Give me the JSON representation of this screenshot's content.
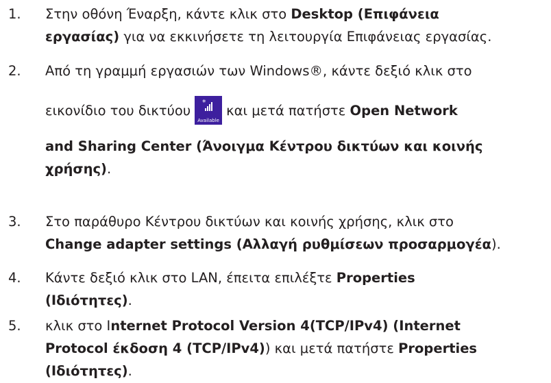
{
  "steps": [
    {
      "number": "1.",
      "line1_pre": "Στην οθόνη Έναρξη, κάντε κλικ στο ",
      "line1_bold": "Desktop (Επιφάνεια",
      "line2_bold": "εργασίας)",
      "line2_post": " για να εκκινήσετε τη λειτουργία Επιφάνειας εργασίας."
    },
    {
      "number": "2.",
      "line1": "Από τη γραμμή εργασιών των Windows®, κάντε δεξιό κλικ στο",
      "line2_pre": "εικονίδιο του δικτύου",
      "icon": {
        "name": "network-icon",
        "label": "Available",
        "color": "#3d1f9e"
      },
      "line2_post": "και μετά πατήστε ",
      "line2_bold": "Open Network",
      "line3_bold": "and Sharing Center (Άνοιγμα Κέντρου δικτύων και κοινής",
      "line4_bold": "χρήσης)",
      "line4_post": "."
    },
    {
      "number": "3.",
      "line1": "Στο παράθυρο Κέντρου δικτύων και κοινής χρήσης, κλικ στο",
      "line2_bold": "Change adapter settings (Αλλαγή ρυθμίσεων προσαρμογέα",
      "line2_post": ")."
    },
    {
      "number": "4.",
      "line1_pre": "Κάντε δεξιό κλικ στο LAN, έπειτα επιλέξτε ",
      "line1_bold": "Properties",
      "line2_bold": "(Ιδιότητες)",
      "line2_post": "."
    },
    {
      "number": "5.",
      "line1_pre": "κλικ στο I",
      "line1_bold": "nternet Protocol Version 4(TCP/IPv4) (Internet",
      "line2_bold": "Protocol έκδοση 4 (TCP/IPv4)",
      "line2_mid": ") και μετά πατήστε ",
      "line2_bold2": "Properties",
      "line3_bold": "(Ιδιότητες)",
      "line3_post": "."
    }
  ]
}
